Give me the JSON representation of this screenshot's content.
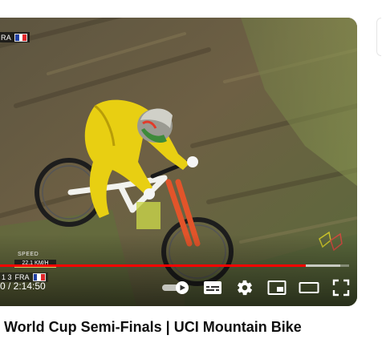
{
  "player": {
    "current_time": "0",
    "time_separator": " / ",
    "duration": "2:14:50",
    "time_display": "0 / 2:14:50",
    "progress_fraction": 0.877,
    "buffer_fraction": 0.975,
    "progress_color": "#ff0000"
  },
  "overlay": {
    "top_country": "RA",
    "speed_label": "SPEED",
    "speed_value": "22.1 KM/H",
    "rank_number": "1 3",
    "rank_country": "FRA",
    "flag_colors": [
      "#1f3fa3",
      "#ffffff",
      "#e0262a"
    ]
  },
  "controls": {
    "autoplay_icon": "autoplay-toggle-icon",
    "subtitles_icon": "subtitles-icon",
    "settings_icon": "gear-icon",
    "miniplayer_icon": "miniplayer-icon",
    "theater_icon": "theater-mode-icon",
    "fullscreen_icon": "fullscreen-icon"
  },
  "video": {
    "title": "World Cup Semi-Finals | UCI Mountain Bike"
  }
}
